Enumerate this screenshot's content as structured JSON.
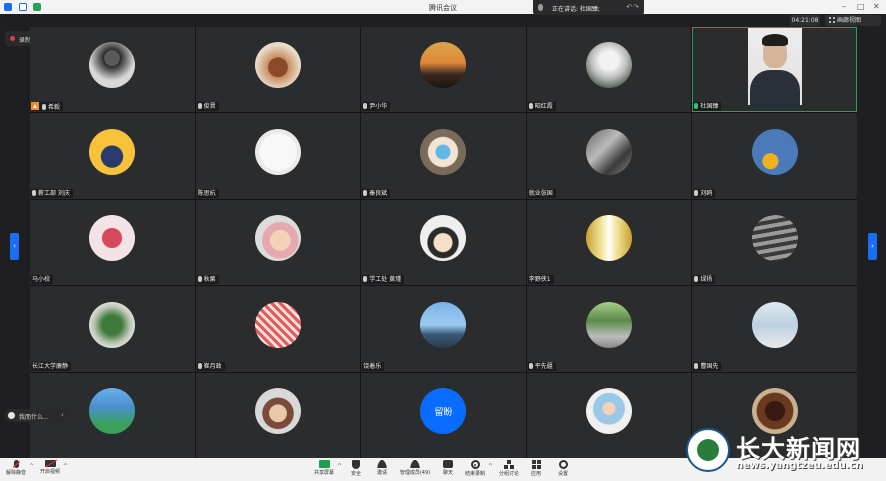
{
  "window": {
    "title": "腾讯会议"
  },
  "speaking": {
    "text": "正在讲话: 杜国臻;"
  },
  "clock": "04:21:08",
  "view_label": "画廊视图",
  "recording": {
    "label": "录制中"
  },
  "chat_preview": "我而什么...",
  "colors": {
    "accent": "#1a6ef5",
    "active_border": "#2aa05a",
    "host": "#f08a24"
  },
  "participants": [
    {
      "name": "希毅",
      "host": true,
      "mic": true,
      "avatar": {
        "bg": "radial-gradient(circle at 50% 35%, #5a5a5a 0 20%, #2a2a2a 22%, #d8d8d8 60%)"
      }
    },
    {
      "name": "俊晋",
      "mic": true,
      "avatar": {
        "bg": "radial-gradient(circle at 50% 55%, #8a4a2a 0 28%, #c98e62 30%, #e8dcc8 65%)"
      }
    },
    {
      "name": "尹小华",
      "mic": true,
      "avatar": {
        "bg": "linear-gradient(180deg,#d9a54a 0%,#e0883a 45%,#3a2a20 70%,#1a1410 100%)"
      }
    },
    {
      "name": "昭红霞",
      "mic": true,
      "avatar": {
        "bg": "radial-gradient(circle at 50% 40%, #f2f2f2 0 25%, #bcbcbc 50%, #4a5a4a 80%)"
      }
    },
    {
      "name": "杜国臻",
      "mic": true,
      "mic_green": true,
      "active": true,
      "video": true
    },
    {
      "name": "薪工部 刘庆",
      "mic": true,
      "avatar": {
        "bg": "radial-gradient(circle at 50% 60%, #2a3a6a 0 30%, #f5c23a 32%)"
      }
    },
    {
      "name": "陈思杭",
      "mic": false,
      "avatar": {
        "bg": "radial-gradient(circle at 50% 50%, #f8f8f8 0 55%, #eaeaea 60%)"
      }
    },
    {
      "name": "秦良斌",
      "mic": true,
      "avatar": {
        "bg": "radial-gradient(circle at 50% 50%, #5fb8e8 0 22%, #f1e4d3 24% 45%, #7a6a5a 48%)"
      }
    },
    {
      "name": "就业张国",
      "mic": false,
      "avatar": {
        "bg": "linear-gradient(135deg,#666 0%,#bbb 40%,#3a3a3a 70%,#888 100%)"
      }
    },
    {
      "name": "刘鸥",
      "mic": true,
      "avatar": {
        "bg": "radial-gradient(circle at 40% 70%, #f0b020 0 18%, #4a7ab8 20%)"
      }
    },
    {
      "name": "马小校",
      "mic": false,
      "avatar": {
        "bg": "radial-gradient(circle at 50% 50%, #d84a5a 0 30%, #f2e4e6 32%)"
      }
    },
    {
      "name": "秋栗",
      "mic": true,
      "avatar": {
        "bg": "radial-gradient(circle at 55% 55%, #f3d2b8 0 28%, #e7a9b0 30% 50%, #dcdcdc 52%)"
      }
    },
    {
      "name": "学工处 黄瑾",
      "mic": true,
      "avatar": {
        "bg": "radial-gradient(circle at 50% 60%, #f5e1c8 0 25%, #2a2a2a 28% 42%, #eeeeee 45%)"
      }
    },
    {
      "name": "李野侠1",
      "mic": false,
      "avatar": {
        "bg": "linear-gradient(90deg,#c8a030 0%,#f3e7a0 35%,#fff 50%,#f3e7a0 65%,#c8a030 100%)"
      }
    },
    {
      "name": "绿扬",
      "mic": true,
      "avatar": {
        "bg": "repeating-linear-gradient(170deg,#3a3a3a 0 4px,#9a9a9a 4px 8px)"
      }
    },
    {
      "name": "长江大学廉静",
      "mic": false,
      "avatar": {
        "bg": "radial-gradient(circle at 50% 50%, #3f7a3a 0 30%, #b8c2b0 55%, #e8e8e8 75%)"
      }
    },
    {
      "name": "崔月政",
      "mic": true,
      "avatar": {
        "bg": "repeating-linear-gradient(45deg,#e25c5c 0 3px,#fbe2e2 3px 6px)"
      }
    },
    {
      "name": "饶着乐",
      "mic": false,
      "avatar": {
        "bg": "linear-gradient(180deg,#7ab4e8 0%,#9ccaf0 50%,#3a5a7a 70%,#2a3a4a 100%)"
      }
    },
    {
      "name": "平先疆",
      "mic": true,
      "avatar": {
        "bg": "linear-gradient(180deg,#a8d088 0%,#5a8a4a 40%,#bcbcbc 75%,#888 100%)"
      }
    },
    {
      "name": "曹国先",
      "mic": true,
      "avatar": {
        "bg": "linear-gradient(180deg,#dfe8f0 0%,#bcd0e0 50%,#eaeaea 100%)"
      }
    },
    {
      "name": "",
      "mic": false,
      "avatar": {
        "bg": "linear-gradient(180deg,#6ab0e8 0%,#4a90d0 40%,#3aa05a 80%)"
      }
    },
    {
      "name": "",
      "mic": false,
      "avatar": {
        "bg": "radial-gradient(circle at 50% 55%, #e8c8a8 0 25%, #7a4a3a 27% 45%, #d8d8d8 47%)"
      }
    },
    {
      "name": "",
      "mic": false,
      "avatar": {
        "text": "留盼",
        "bg": "#0a6cff"
      }
    },
    {
      "name": "",
      "mic": false,
      "avatar": {
        "bg": "radial-gradient(circle at 50% 45%, #f3d2b8 0 18%, #9ac8e8 20% 45%, #f0f0f0 48%)"
      }
    },
    {
      "name": "",
      "mic": false,
      "avatar": {
        "bg": "radial-gradient(circle at 50% 50%, #3a1a10 0 30%, #6a3a20 32% 55%, #c8b090 58%)"
      }
    }
  ],
  "toolbar": {
    "left": [
      {
        "label": "解除静音",
        "icon": "mic-muted-icon"
      },
      {
        "label": "开启视频",
        "icon": "camera-off-icon"
      }
    ],
    "center": [
      {
        "label": "共享屏幕",
        "icon": "share-screen-icon"
      },
      {
        "label": "安全",
        "icon": "shield-icon"
      },
      {
        "label": "邀请",
        "icon": "invite-icon"
      },
      {
        "label": "管理成员(49)",
        "icon": "members-icon"
      },
      {
        "label": "聊天",
        "icon": "chat-icon"
      },
      {
        "label": "结束录制",
        "icon": "record-icon"
      },
      {
        "label": "分组讨论",
        "icon": "breakout-icon"
      },
      {
        "label": "应用",
        "icon": "apps-icon"
      },
      {
        "label": "设置",
        "icon": "gear-icon"
      }
    ]
  },
  "watermark": {
    "title": "长大新闻网",
    "url": "news.yangtzeu.edu.cn"
  }
}
